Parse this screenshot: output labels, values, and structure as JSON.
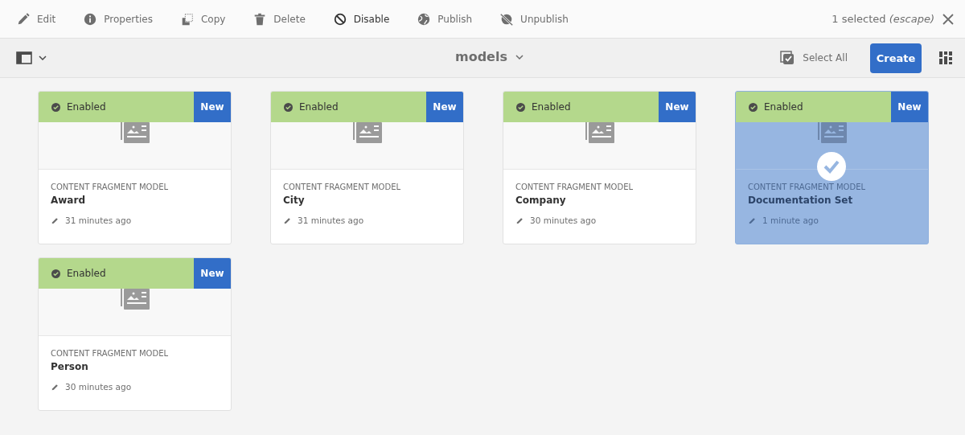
{
  "actions": [
    {
      "kind": "edit",
      "label": "Edit",
      "highlighted": false
    },
    {
      "kind": "properties",
      "label": "Properties",
      "highlighted": false
    },
    {
      "kind": "copy",
      "label": "Copy",
      "highlighted": false
    },
    {
      "kind": "delete",
      "label": "Delete",
      "highlighted": false
    },
    {
      "kind": "disable",
      "label": "Disable",
      "highlighted": true
    },
    {
      "kind": "publish",
      "label": "Publish",
      "highlighted": false
    },
    {
      "kind": "unpublish",
      "label": "Unpublish",
      "highlighted": false
    }
  ],
  "selection": {
    "text": "1 selected *(escape)*"
  },
  "title": "models",
  "select_all": "Select All",
  "create": "Create",
  "cards": [
    {
      "status": "Enabled",
      "badge": "New",
      "type": "CONTENT FRAGMENT MODEL",
      "name": "Award",
      "modified": "31 minutes ago",
      "selected": false
    },
    {
      "status": "Enabled",
      "badge": "New",
      "type": "CONTENT FRAGMENT MODEL",
      "name": "City",
      "modified": "31 minutes ago",
      "selected": false
    },
    {
      "status": "Enabled",
      "badge": "New",
      "type": "CONTENT FRAGMENT MODEL",
      "name": "Company",
      "modified": "30 minutes ago",
      "selected": false
    },
    {
      "status": "Enabled",
      "badge": "New",
      "type": "CONTENT FRAGMENT MODEL",
      "name": "Documentation Set",
      "modified": "1 minute ago",
      "selected": true
    },
    {
      "status": "Enabled",
      "badge": "New",
      "type": "CONTENT FRAGMENT MODEL",
      "name": "Person",
      "modified": "30 minutes ago",
      "selected": false
    }
  ]
}
